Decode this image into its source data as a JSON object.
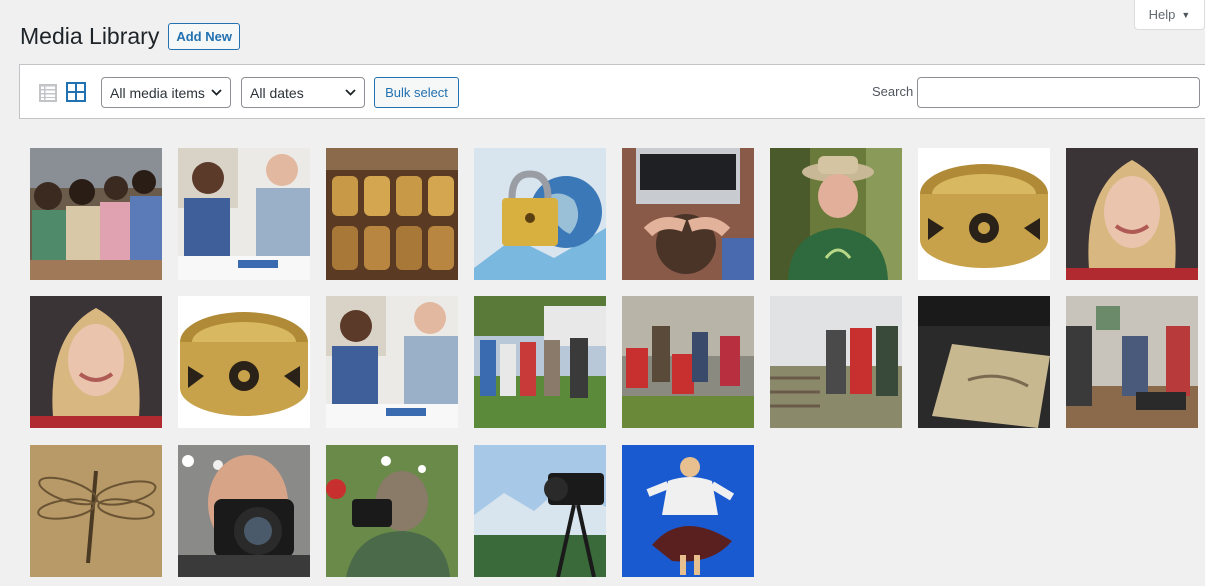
{
  "help": {
    "label": "Help"
  },
  "header": {
    "title": "Media Library",
    "add_new": "Add New"
  },
  "toolbar": {
    "media_filter": "All media items",
    "date_filter": "All dates",
    "bulk_select": "Bulk select",
    "search_label": "Search",
    "search_value": ""
  },
  "media_items": [
    "classroom-students-thumbnail",
    "man-woman-meeting-thumbnail",
    "carved-golden-panels-thumbnail",
    "padlock-globe-thumbnail",
    "man-laptop-thumbnail",
    "man-hat-outdoors-thumbnail",
    "gold-ring-thumbnail",
    "blonde-woman-portrait-thumbnail",
    "blonde-woman-portrait-thumbnail",
    "gold-ring-thumbnail",
    "man-woman-meeting-thumbnail",
    "group-hikers-field-thumbnail",
    "group-seated-stone-wall-thumbnail",
    "group-at-gate-thumbnail",
    "fossil-fish-slab-thumbnail",
    "office-workers-thumbnail",
    "dragonfly-fossil-thumbnail",
    "man-with-camera-thumbnail",
    "woman-with-camera-thumbnail",
    "camera-tripod-mountains-thumbnail",
    "dancer-blue-background-thumbnail"
  ]
}
